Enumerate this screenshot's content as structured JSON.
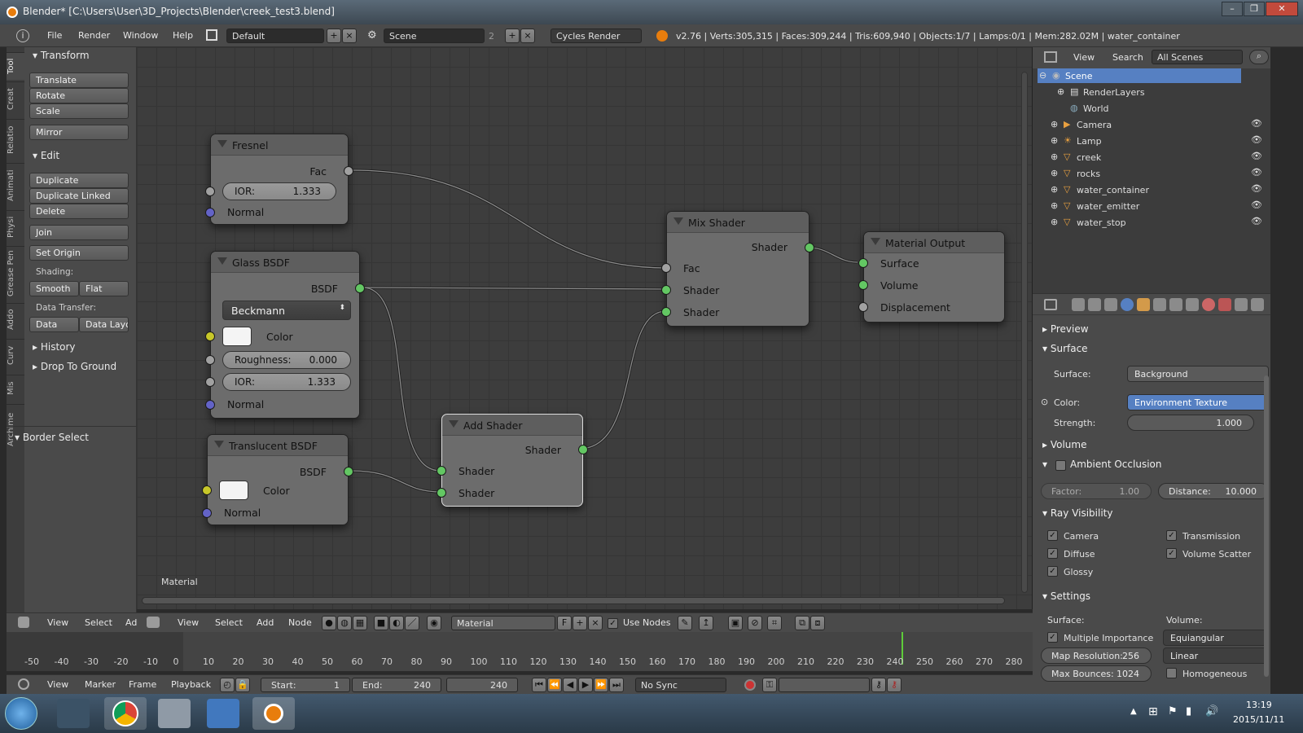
{
  "window": {
    "title": "Blender* [C:\\Users\\User\\3D_Projects\\Blender\\creek_test3.blend]",
    "controls": [
      "–",
      "❐",
      "✕"
    ]
  },
  "top_menu": {
    "items": [
      "File",
      "Render",
      "Window",
      "Help"
    ],
    "layout": "Default",
    "scene": "Scene",
    "scene_count": "2",
    "engine": "Cycles Render",
    "stats": "v2.76 | Verts:305,315 | Faces:309,244 | Tris:609,940 | Objects:1/7 | Lamps:0/1 | Mem:282.02M | water_container"
  },
  "tool_tabs": [
    "Tool",
    "Creat",
    "Relatio",
    "Animati",
    "Physi",
    "Grease Pen",
    "Addo",
    "Curv",
    "Mis",
    "Archime"
  ],
  "tool_panel": {
    "transform_title": "Transform",
    "transform_buttons": [
      "Translate",
      "Rotate",
      "Scale"
    ],
    "mirror": "Mirror",
    "edit_title": "Edit",
    "edit_buttons": [
      "Duplicate",
      "Duplicate Linked",
      "Delete"
    ],
    "join": "Join",
    "set_origin": "Set Origin",
    "shading_label": "Shading:",
    "smooth": "Smooth",
    "flat": "Flat",
    "data_transfer_label": "Data Transfer:",
    "data": "Data",
    "data_layout": "Data Layo",
    "history": "History",
    "drop_to_ground": "Drop To Ground",
    "border_select": "Border Select"
  },
  "node_editor": {
    "footer_label": "Material",
    "nodes": {
      "fresnel": {
        "title": "Fresnel",
        "out": "Fac",
        "ior_label": "IOR:",
        "ior": "1.333",
        "normal": "Normal"
      },
      "glass": {
        "title": "Glass BSDF",
        "out": "BSDF",
        "distribution": "Beckmann",
        "color": "Color",
        "roughness_label": "Roughness:",
        "roughness": "0.000",
        "ior_label": "IOR:",
        "ior": "1.333",
        "normal": "Normal"
      },
      "translucent": {
        "title": "Translucent BSDF",
        "out": "BSDF",
        "color": "Color",
        "normal": "Normal"
      },
      "add": {
        "title": "Add Shader",
        "out": "Shader",
        "in1": "Shader",
        "in2": "Shader"
      },
      "mix": {
        "title": "Mix Shader",
        "out": "Shader",
        "fac": "Fac",
        "in1": "Shader",
        "in2": "Shader"
      },
      "output": {
        "title": "Material Output",
        "surface": "Surface",
        "volume": "Volume",
        "displacement": "Displacement"
      }
    }
  },
  "node_header": {
    "items": [
      "View",
      "Select",
      "Add",
      "Node"
    ],
    "left_items": [
      "View",
      "Select",
      "Ad"
    ],
    "material": "Material",
    "fake_user": "F",
    "use_nodes": "Use Nodes"
  },
  "outliner": {
    "header": [
      "View",
      "Search"
    ],
    "filter": "All Scenes",
    "items": [
      {
        "label": "Scene",
        "selected": true
      },
      {
        "label": "RenderLayers"
      },
      {
        "label": "World"
      },
      {
        "label": "Camera"
      },
      {
        "label": "Lamp"
      },
      {
        "label": "creek"
      },
      {
        "label": "rocks"
      },
      {
        "label": "water_container"
      },
      {
        "label": "water_emitter"
      },
      {
        "label": "water_stop"
      }
    ]
  },
  "properties": {
    "preview": "Preview",
    "surface_section": "Surface",
    "surface_label": "Surface:",
    "surface_value": "Background",
    "color_label": "Color:",
    "color_value": "Environment Texture",
    "strength_label": "Strength:",
    "strength_value": "1.000",
    "volume_section": "Volume",
    "ao_section": "Ambient Occlusion",
    "factor_label": "Factor:",
    "factor_value": "1.00",
    "distance_label": "Distance:",
    "distance_value": "10.000",
    "ray_vis_section": "Ray Visibility",
    "ray_left": [
      "Camera",
      "Diffuse",
      "Glossy"
    ],
    "ray_right": [
      "Transmission",
      "Volume Scatter"
    ],
    "settings_section": "Settings",
    "settings_surface_label": "Surface:",
    "settings_volume_label": "Volume:",
    "multiple_importance": "Multiple Importance",
    "map_res_label": "Map Resolution:",
    "map_res_value": "256",
    "max_bounces_label": "Max Bounces:",
    "max_bounces_value": "1024",
    "volume_sampling": "Equiangular",
    "volume_interp": "Linear",
    "homogeneous": "Homogeneous"
  },
  "timeline": {
    "ticks": [
      "-50",
      "-40",
      "-30",
      "-20",
      "-10",
      "0",
      "10",
      "20",
      "30",
      "40",
      "50",
      "60",
      "70",
      "80",
      "90",
      "100",
      "110",
      "120",
      "130",
      "140",
      "150",
      "160",
      "170",
      "180",
      "190",
      "200",
      "210",
      "220",
      "230",
      "240",
      "250",
      "260",
      "270",
      "280"
    ],
    "current_frame": 240,
    "menu": [
      "View",
      "Marker",
      "Frame",
      "Playback"
    ],
    "start_label": "Start:",
    "start": "1",
    "end_label": "End:",
    "end": "240",
    "frame": "240",
    "sync": "No Sync"
  },
  "taskbar": {
    "time": "13:19",
    "date": "2015/11/11"
  }
}
